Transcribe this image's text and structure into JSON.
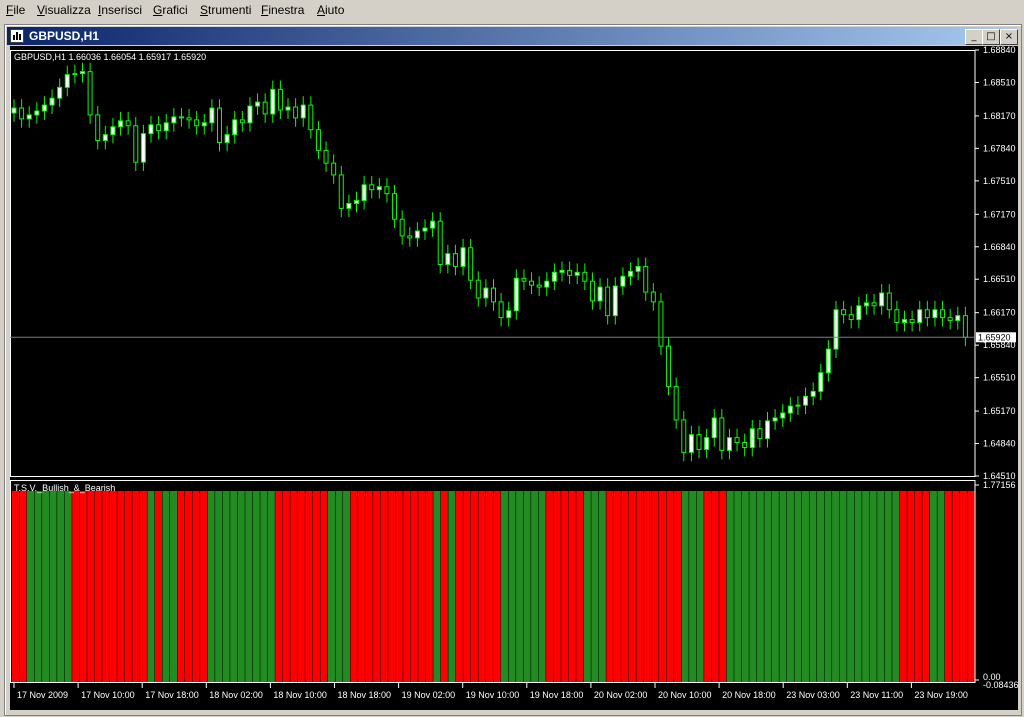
{
  "menu": [
    "File",
    "Visualizza",
    "Inserisci",
    "Grafici",
    "Strumenti",
    "Finestra",
    "Aiuto"
  ],
  "menu_underline": [
    "F",
    "V",
    "I",
    "G",
    "S",
    "F",
    "A"
  ],
  "window": {
    "title": "GBPUSD,H1",
    "buttons": [
      "minimize",
      "maximize",
      "close"
    ]
  },
  "chart_header": "GBPUSD,H1  1.66036 1.66054 1.65917 1.65920",
  "current_price_label": "1.65920",
  "indicator_name": "T.S.V._Bullish_&_Bearish",
  "colors": {
    "bull_candle": "#ffffff",
    "candle_wick": "#00ff00",
    "bull_bar": "#228b22",
    "bear_bar": "#ff0000",
    "price_line": "#708090",
    "axis": "#ffffff"
  },
  "chart_data": [
    {
      "type": "candlestick",
      "title": "GBPUSD,H1",
      "ylim": [
        1.6451,
        1.6884
      ],
      "yticks": [
        "1.68840",
        "1.68510",
        "1.68170",
        "1.67840",
        "1.67510",
        "1.67170",
        "1.66840",
        "1.66510",
        "1.66170",
        "1.65840",
        "1.65510",
        "1.65170",
        "1.64840",
        "1.64510"
      ],
      "xticks": [
        "17 Nov 2009",
        "17 Nov 10:00",
        "17 Nov 18:00",
        "18 Nov 02:00",
        "18 Nov 10:00",
        "18 Nov 18:00",
        "19 Nov 02:00",
        "19 Nov 10:00",
        "19 Nov 18:00",
        "20 Nov 02:00",
        "20 Nov 10:00",
        "20 Nov 18:00",
        "23 Nov 03:00",
        "23 Nov 11:00",
        "23 Nov 19:00"
      ],
      "close": [
        1.6825,
        1.6814,
        1.6818,
        1.6822,
        1.6828,
        1.6835,
        1.6846,
        1.6859,
        1.686,
        1.6862,
        1.6818,
        1.6792,
        1.6798,
        1.6806,
        1.6812,
        1.6807,
        1.677,
        1.6799,
        1.6808,
        1.6802,
        1.681,
        1.6816,
        1.6815,
        1.6813,
        1.6807,
        1.681,
        1.6825,
        1.679,
        1.6798,
        1.6813,
        1.681,
        1.6827,
        1.6831,
        1.6819,
        1.6844,
        1.6823,
        1.6826,
        1.6815,
        1.6828,
        1.6803,
        1.6782,
        1.6769,
        1.6757,
        1.6723,
        1.6728,
        1.6731,
        1.6747,
        1.6742,
        1.6745,
        1.6738,
        1.6712,
        1.6695,
        1.6693,
        1.67,
        1.6703,
        1.671,
        1.6666,
        1.6677,
        1.6664,
        1.6683,
        1.665,
        1.6632,
        1.6642,
        1.6628,
        1.6612,
        1.6619,
        1.6652,
        1.6649,
        1.6645,
        1.6643,
        1.6649,
        1.6658,
        1.666,
        1.6655,
        1.6658,
        1.6649,
        1.6629,
        1.6643,
        1.6614,
        1.6644,
        1.6654,
        1.6659,
        1.6664,
        1.6638,
        1.6628,
        1.6583,
        1.6542,
        1.6508,
        1.6475,
        1.6493,
        1.6478,
        1.649,
        1.651,
        1.6477,
        1.649,
        1.6485,
        1.648,
        1.6499,
        1.6489,
        1.6507,
        1.651,
        1.6515,
        1.6522,
        1.6523,
        1.6532,
        1.6537,
        1.6556,
        1.658,
        1.662,
        1.6615,
        1.661,
        1.6624,
        1.6627,
        1.6624,
        1.6637,
        1.662,
        1.6607,
        1.661,
        1.6607,
        1.662,
        1.6612,
        1.662,
        1.6612,
        1.6609,
        1.6614,
        1.6592
      ],
      "current_price": 1.6592
    },
    {
      "type": "bar",
      "title": "T.S.V._Bullish_&_Bearish",
      "ylim": [
        0.0,
        1.77156
      ],
      "yticks": [
        "1.77156",
        "0.00"
      ],
      "bottom_tick": "-0.08436",
      "sign": [
        -1,
        -1,
        1,
        1,
        1,
        1,
        1,
        1,
        -1,
        -1,
        -1,
        -1,
        -1,
        -1,
        -1,
        -1,
        -1,
        -1,
        1,
        -1,
        1,
        1,
        -1,
        -1,
        -1,
        -1,
        1,
        1,
        1,
        1,
        1,
        1,
        1,
        1,
        1,
        -1,
        -1,
        -1,
        -1,
        -1,
        -1,
        -1,
        1,
        1,
        1,
        -1,
        -1,
        -1,
        -1,
        -1,
        -1,
        -1,
        -1,
        -1,
        -1,
        -1,
        1,
        -1,
        1,
        -1,
        -1,
        -1,
        -1,
        -1,
        -1,
        1,
        1,
        1,
        1,
        1,
        1,
        -1,
        -1,
        -1,
        -1,
        -1,
        1,
        1,
        1,
        -1,
        -1,
        -1,
        -1,
        -1,
        -1,
        -1,
        -1,
        -1,
        -1,
        1,
        1,
        1,
        -1,
        -1,
        -1,
        1,
        1,
        1,
        1,
        1,
        1,
        1,
        1,
        1,
        1,
        1,
        1,
        1,
        1,
        1,
        1,
        1,
        1,
        1,
        1,
        1,
        1,
        1,
        -1,
        -1,
        -1,
        -1,
        1,
        1,
        -1,
        -1,
        -1,
        -1
      ]
    }
  ]
}
